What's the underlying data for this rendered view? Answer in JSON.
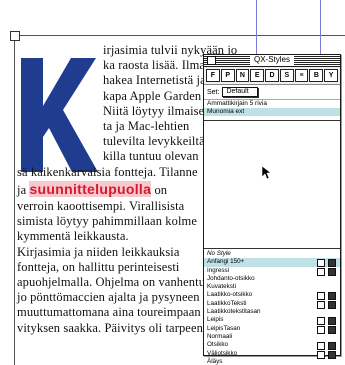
{
  "document": {
    "lines_short": [
      "irjasimia tulvii nykyään jo",
      "ka raosta lisää. Ilmaisiakin",
      "hakea Internetistä ja sitä",
      "kapa Apple Garden ja mac",
      "Niitä löytyy ilmaiseksi",
      "ta ja Mac-lehtien",
      "tulevilta levykkeiltä",
      "killa tuntuu olevan"
    ],
    "line_after_cap": "sä kaikenkarvaisia fontteja. Tilanne",
    "highlight_prefix": "ja ",
    "highlight": "suunnittelupuolla",
    "highlight_suffix": " on",
    "lines_full": [
      "verroin kaoottisempi. Virallisista",
      "simista löytyy pahimmillaan kolme",
      "kymmentä leikkausta.",
      "    Kirjasimia ja niiden leikkauksia",
      "fontteja, on hallittu perinteisesti",
      "apuohjelmalla. Ohjelma on vanhentunut",
      "jo pönttömaccien ajalta ja pysyneen",
      "muuttumattomana aina toureimpaan",
      "vityksen saakka. Päivitys oli tarpeen muu-"
    ]
  },
  "palette": {
    "title": "QX-Styles",
    "toolbar_buttons": [
      "F",
      "P",
      "N",
      "E",
      "D",
      "S",
      "≡",
      "B",
      "Y"
    ],
    "set_label": "Set:",
    "set_value": "Default",
    "set_items": [
      "Ammattikirjain 5 rivia",
      "Munomia ext"
    ],
    "style_items": [
      {
        "label": "No Style",
        "italic": true,
        "active": false,
        "icons": 0
      },
      {
        "label": "Anfangi 150+",
        "italic": false,
        "active": true,
        "icons": 2
      },
      {
        "label": "Ingressi",
        "italic": false,
        "active": false,
        "icons": 2
      },
      {
        "label": "Johdanto-otsikko",
        "italic": false,
        "active": false,
        "icons": 0
      },
      {
        "label": "Kuvateksti",
        "italic": false,
        "active": false,
        "icons": 0
      },
      {
        "label": "Laatikko-otsikko",
        "italic": false,
        "active": false,
        "icons": 2
      },
      {
        "label": "LaatikkoTeksti",
        "italic": false,
        "active": false,
        "icons": 2
      },
      {
        "label": "Laatikkotekstitasan",
        "italic": false,
        "active": false,
        "icons": 0
      },
      {
        "label": "Leipis",
        "italic": false,
        "active": false,
        "icons": 2
      },
      {
        "label": "LeipisTasan",
        "italic": false,
        "active": false,
        "icons": 2
      },
      {
        "label": "Normaali",
        "italic": false,
        "active": false,
        "icons": 0
      },
      {
        "label": "Otsikko",
        "italic": false,
        "active": false,
        "icons": 2
      },
      {
        "label": "Väliotsikko",
        "italic": false,
        "active": false,
        "icons": 2
      },
      {
        "label": "Äläys",
        "italic": false,
        "active": false,
        "icons": 0
      }
    ]
  },
  "colors": {
    "dropcap": "#1f3c8e",
    "highlight_text": "#d8192a",
    "highlight_bg": "#f5c9cf",
    "selection": "#bfe0e7"
  },
  "dropcap_letter": "K"
}
